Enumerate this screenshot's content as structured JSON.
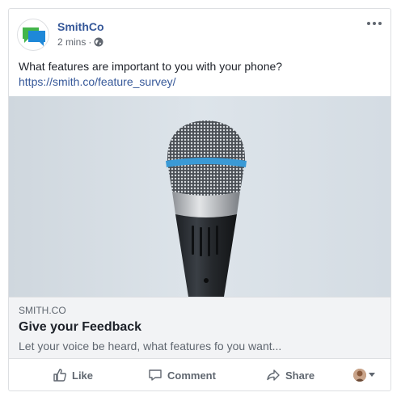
{
  "post": {
    "page_name": "SmithCo",
    "time": "2 mins",
    "separator": "·",
    "privacy_icon": "globe-icon",
    "more_icon": "more-dots-icon",
    "text": "What features are important to you with your phone?",
    "link": "https://smith.co/feature_survey/"
  },
  "preview": {
    "image_subject": "microphone",
    "domain": "SMITH.CO",
    "title": "Give your Feedback",
    "description": "Let your voice be heard, what features fo you want..."
  },
  "actions": {
    "like_label": "Like",
    "comment_label": "Comment",
    "share_label": "Share"
  },
  "colors": {
    "link_blue": "#365899",
    "text_dark": "#1d2129",
    "text_muted": "#606770",
    "logo_green": "#43b54a",
    "logo_blue": "#1e88d8",
    "mic_ring": "#3a9ad6"
  }
}
